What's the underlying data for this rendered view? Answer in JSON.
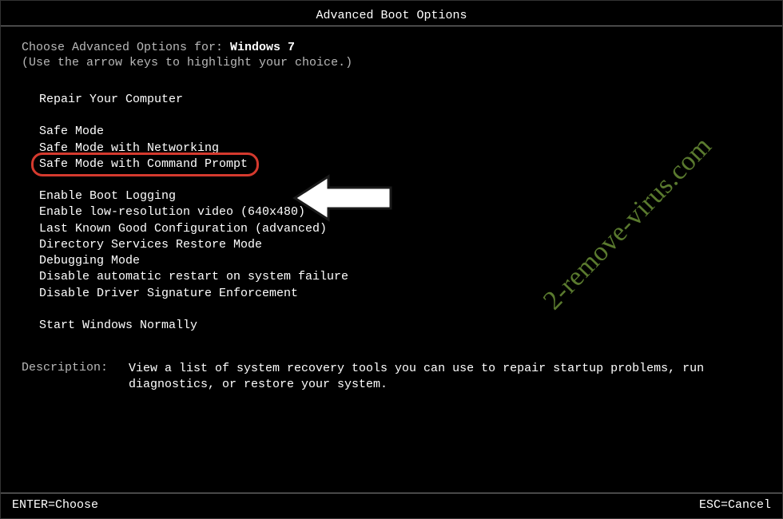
{
  "title": "Advanced Boot Options",
  "prompt": {
    "prefix": "Choose Advanced Options for: ",
    "os": "Windows 7",
    "hint": "(Use the arrow keys to highlight your choice.)"
  },
  "menu": {
    "repair": "Repair Your Computer",
    "group2": [
      "Safe Mode",
      "Safe Mode with Networking",
      "Safe Mode with Command Prompt"
    ],
    "group3": [
      "Enable Boot Logging",
      "Enable low-resolution video (640x480)",
      "Last Known Good Configuration (advanced)",
      "Directory Services Restore Mode",
      "Debugging Mode",
      "Disable automatic restart on system failure",
      "Disable Driver Signature Enforcement"
    ],
    "normal": "Start Windows Normally"
  },
  "description": {
    "label": "Description:",
    "text": "View a list of system recovery tools you can use to repair startup problems, run diagnostics, or restore your system."
  },
  "footer": {
    "enter": "ENTER=Choose",
    "esc": "ESC=Cancel"
  },
  "watermark": "2-remove-virus.com"
}
